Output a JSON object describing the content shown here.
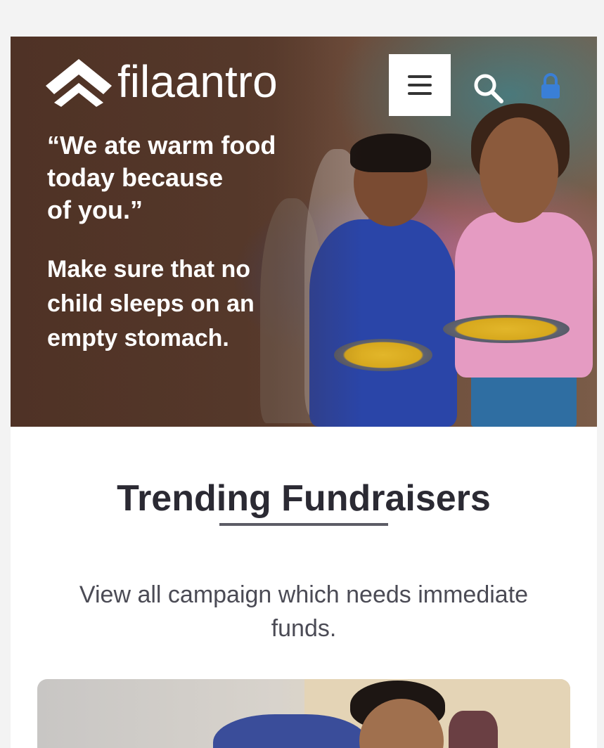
{
  "brand": {
    "name": "filaantro"
  },
  "header": {
    "menu_icon": "hamburger-menu-icon",
    "search_icon": "search-icon",
    "lock_icon": "lock-icon"
  },
  "hero": {
    "quote_lines": [
      "“We ate warm food",
      "today because",
      "of you.”"
    ],
    "tagline_lines": [
      "Make sure that no",
      "child sleeps on an",
      "empty stomach."
    ]
  },
  "trending": {
    "title": "Trending Fundraisers",
    "subtitle_lines": [
      "View all campaign which needs immediate",
      "funds."
    ]
  },
  "colors": {
    "title_text": "#2b2a33",
    "body_text": "#4b4b55",
    "underline": "#5c5c66",
    "hero_overlay": "#5a3a2c"
  }
}
